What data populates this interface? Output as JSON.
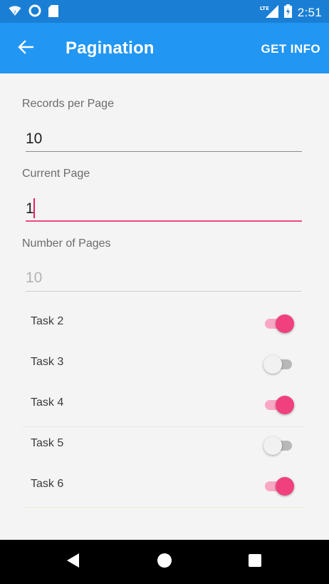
{
  "status_bar": {
    "time": "2:51",
    "network": "LTE",
    "icons": [
      "wifi-icon",
      "circle-icon",
      "sd-card-icon",
      "signal-icon",
      "battery-icon"
    ]
  },
  "app_bar": {
    "title": "Pagination",
    "action_label": "GET INFO",
    "back_icon": "arrow-left-icon",
    "color": "#2196f3"
  },
  "form": {
    "records_per_page": {
      "label": "Records per Page",
      "value": "10"
    },
    "current_page": {
      "label": "Current Page",
      "value": "1"
    },
    "number_of_pages": {
      "label": "Number of Pages",
      "value": "10"
    }
  },
  "tasks": [
    {
      "label": "Task 2",
      "on": true
    },
    {
      "label": "Task 3",
      "on": false
    },
    {
      "label": "Task 4",
      "on": true
    },
    {
      "label": "Task 5",
      "on": false
    },
    {
      "label": "Task 6",
      "on": true
    }
  ],
  "accent_color": "#f0407e",
  "nav_bar": {
    "icons": [
      "back-triangle-icon",
      "home-circle-icon",
      "recents-square-icon"
    ]
  }
}
